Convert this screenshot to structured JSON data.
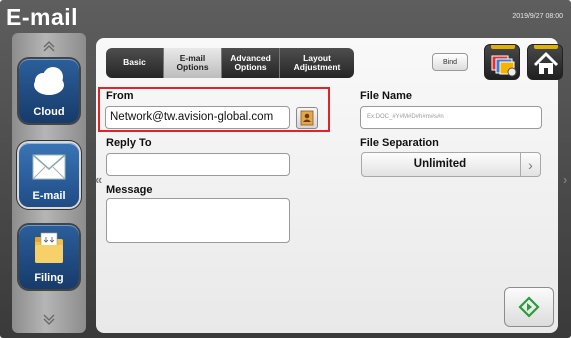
{
  "header": {
    "title": "E-mail",
    "datetime": "2019/9/27 08:00"
  },
  "sidebar": {
    "items": [
      {
        "label": "Cloud",
        "icon": "cloud-icon"
      },
      {
        "label": "E-mail",
        "icon": "envelope-icon",
        "active": true
      },
      {
        "label": "Filing",
        "icon": "folder-icon"
      }
    ],
    "scroll_up_icon": "chevron-up-icon",
    "scroll_down_icon": "chevron-down-icon"
  },
  "tabs": [
    {
      "label": "Basic",
      "active": false
    },
    {
      "label": "E-mail Options",
      "active": true
    },
    {
      "label": "Advanced Options",
      "active": false
    },
    {
      "label": "Layout Adjustment",
      "active": false
    }
  ],
  "toolbar": {
    "bind_label": "Bind",
    "gallery_icon": "gallery-icon",
    "home_icon": "home-icon"
  },
  "form": {
    "from_label": "From",
    "from_value": "Network@tw.avision-global.com",
    "reply_to_label": "Reply To",
    "reply_to_value": "",
    "message_label": "Message",
    "message_value": "",
    "file_name_label": "File Name",
    "file_name_placeholder": "Ex:DOC_#Y#M#D#h#m#s#n",
    "file_separation_label": "File Separation",
    "file_separation_value": "Unlimited"
  },
  "nav": {
    "prev_symbol": "«",
    "next_symbol": "›"
  },
  "colors": {
    "accent_blue": "#1f4c86",
    "highlight_red": "#e2232a",
    "start_green": "#2a9d3a",
    "tab_bar_yellow": "#e2b100"
  }
}
